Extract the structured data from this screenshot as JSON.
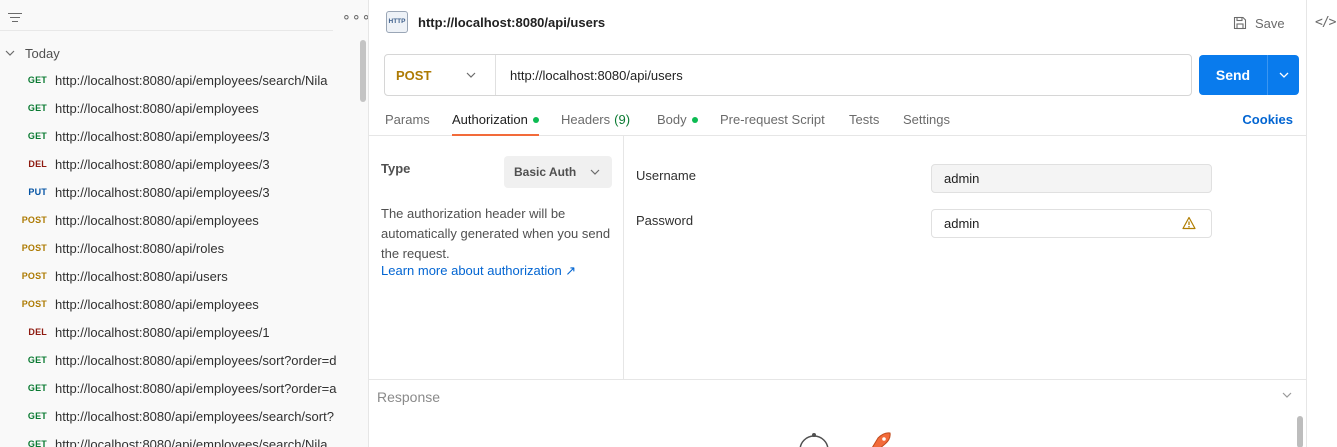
{
  "sidebar": {
    "group_label": "Today",
    "history": [
      {
        "method": "GET",
        "url": "http://localhost:8080/api/employees/search/Nila"
      },
      {
        "method": "GET",
        "url": "http://localhost:8080/api/employees"
      },
      {
        "method": "GET",
        "url": "http://localhost:8080/api/employees/3"
      },
      {
        "method": "DEL",
        "url": "http://localhost:8080/api/employees/3"
      },
      {
        "method": "PUT",
        "url": "http://localhost:8080/api/employees/3"
      },
      {
        "method": "POST",
        "url": "http://localhost:8080/api/employees"
      },
      {
        "method": "POST",
        "url": "http://localhost:8080/api/roles"
      },
      {
        "method": "POST",
        "url": "http://localhost:8080/api/users"
      },
      {
        "method": "POST",
        "url": "http://localhost:8080/api/employees"
      },
      {
        "method": "DEL",
        "url": "http://localhost:8080/api/employees/1"
      },
      {
        "method": "GET",
        "url": "http://localhost:8080/api/employees/sort?order=d"
      },
      {
        "method": "GET",
        "url": "http://localhost:8080/api/employees/sort?order=a"
      },
      {
        "method": "GET",
        "url": "http://localhost:8080/api/employees/search/sort?"
      },
      {
        "method": "GET",
        "url": "http://localhost:8080/api/employees/search/Nila"
      }
    ]
  },
  "request": {
    "icon_text": "HTTP",
    "title": "http://localhost:8080/api/users",
    "save_label": "Save",
    "method": "POST",
    "url": "http://localhost:8080/api/users",
    "send_label": "Send"
  },
  "tabs": {
    "params": "Params",
    "authorization": "Authorization",
    "headers": "Headers",
    "headers_count": "(9)",
    "body": "Body",
    "prerequest": "Pre-request Script",
    "tests": "Tests",
    "settings": "Settings",
    "cookies": "Cookies"
  },
  "auth": {
    "type_label": "Type",
    "type_value": "Basic Auth",
    "description": "The authorization header will be automatically generated when you send the request.",
    "learn_more": "Learn more about authorization ↗",
    "username_label": "Username",
    "username_value": "admin",
    "password_label": "Password",
    "password_value": "admin"
  },
  "response": {
    "label": "Response"
  },
  "right_strip": {
    "code_icon_text": "</>"
  },
  "colors": {
    "send": "#097bed",
    "get": "#0a7a32",
    "post": "#ad7a03",
    "del": "#8e1a10",
    "put": "#0353a4",
    "active_tab": "#f26b3a",
    "status_dot": "#0cbb52",
    "link": "#0265d2"
  }
}
